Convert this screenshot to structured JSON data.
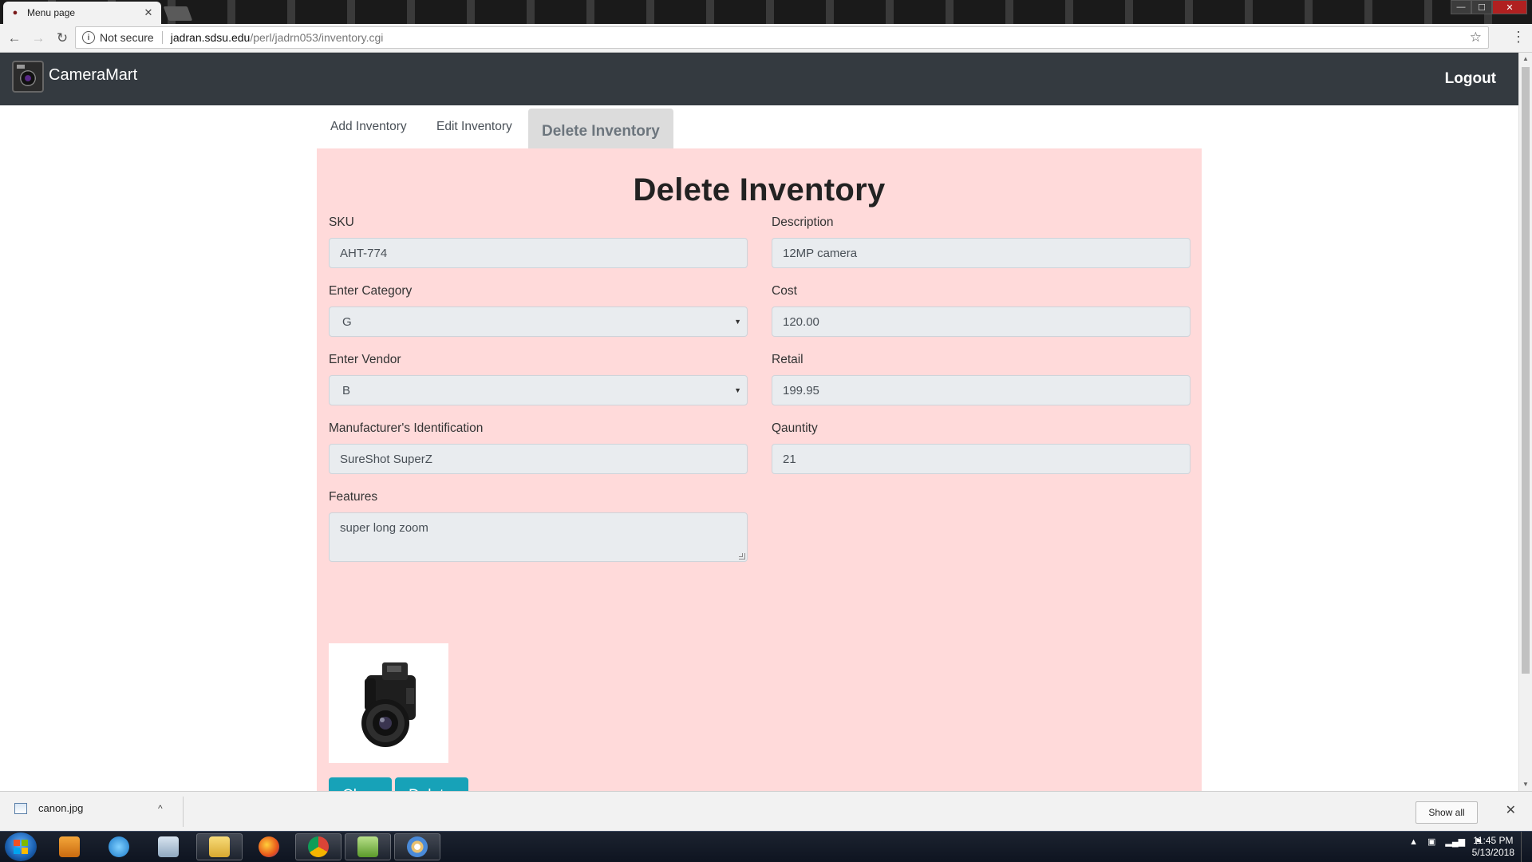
{
  "browser": {
    "tab_title": "Menu page",
    "tab_close": "✕",
    "security_label": "Not secure",
    "url_host": "jadran.sdsu.edu",
    "url_path": "/perl/jadrn053/inventory.cgi",
    "star": "☆",
    "menu": "⋮",
    "back": "←",
    "forward": "→",
    "reload": "↻",
    "win_min": "—",
    "win_max": "☐",
    "win_close": "✕"
  },
  "navbar": {
    "brand": "CameraMart",
    "logout": "Logout"
  },
  "tabs": {
    "add": "Add Inventory",
    "edit": "Edit Inventory",
    "delete": "Delete Inventory"
  },
  "form": {
    "title": "Delete Inventory",
    "sku": {
      "label": "SKU",
      "value": "AHT-774"
    },
    "category": {
      "label": "Enter Category",
      "value": "G"
    },
    "vendor": {
      "label": "Enter Vendor",
      "value": "B"
    },
    "manufacturer_id": {
      "label": "Manufacturer's Identification",
      "value": "SureShot SuperZ"
    },
    "features": {
      "label": "Features",
      "value": "super long zoom"
    },
    "description": {
      "label": "Description",
      "value": "12MP camera"
    },
    "cost": {
      "label": "Cost",
      "value": "120.00"
    },
    "retail": {
      "label": "Retail",
      "value": "199.95"
    },
    "quantity": {
      "label": "Qauntity",
      "value": "21"
    },
    "caret": "▼",
    "clear_button": "Clear",
    "delete_button": "Delete"
  },
  "downloads": {
    "file_name": "canon.jpg",
    "chevron": "^",
    "show_all": "Show all",
    "close": "✕"
  },
  "taskbar": {
    "time": "11:45 PM",
    "date": "5/13/2018",
    "tray_expand": "▲"
  },
  "colors": {
    "navbar": "#343a40",
    "panel": "#ffdada",
    "button": "#17a2b8",
    "active_tab": "#dcdcdc"
  }
}
